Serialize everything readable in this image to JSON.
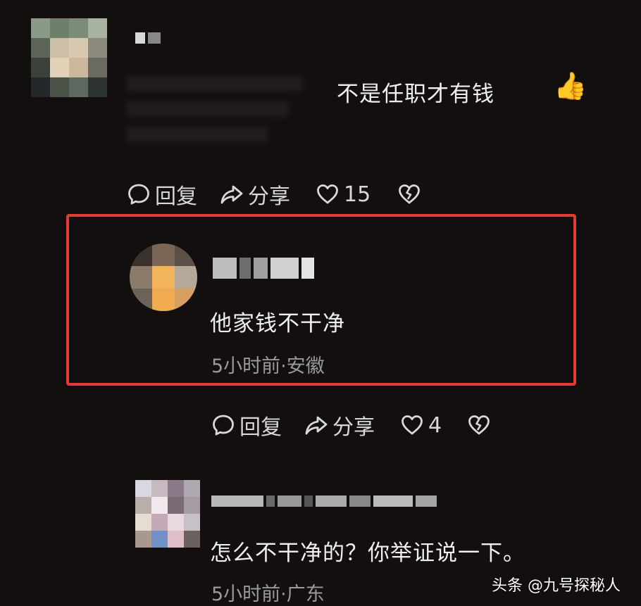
{
  "comment1": {
    "text": "不是任职才有钱",
    "emoji": "👍",
    "actions": {
      "reply": "回复",
      "share": "分享",
      "likes": "15"
    }
  },
  "comment2": {
    "text": "他家钱不干净",
    "meta": "5小时前·安徽",
    "actions": {
      "reply": "回复",
      "share": "分享",
      "likes": "4"
    }
  },
  "comment3": {
    "text": "怎么不干净的？你举证说一下。",
    "meta": "5小时前·广东"
  },
  "watermark": "头条 @九号探秘人",
  "colors": {
    "background": "#120f0e",
    "highlight": "#e03b34",
    "meta_text": "#9a9a9a",
    "icon": "#d8d8d8"
  },
  "icons": {
    "reply": "comment-bubble-icon",
    "share": "share-arrow-icon",
    "like": "heart-outline-icon",
    "dislike": "broken-heart-icon",
    "emoji": "thumbs-up-emoji"
  }
}
